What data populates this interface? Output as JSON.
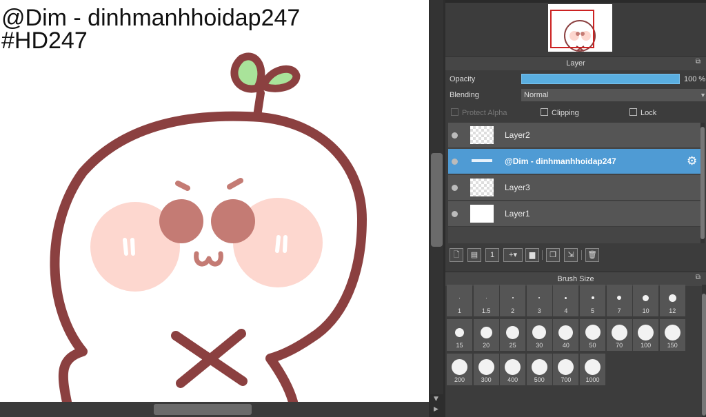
{
  "canvas": {
    "watermark_line1": "@Dim - dinhmanhhoidap247",
    "watermark_line2": "#HD247"
  },
  "navigator": {
    "thumb_caption": "@Dim - dinhmanhhoidap247"
  },
  "layer_panel": {
    "title": "Layer",
    "opacity_label": "Opacity",
    "opacity_value_text": "100 %",
    "opacity_percent": 100,
    "blending_label": "Blending",
    "blending_value": "Normal",
    "protect_alpha_label": "Protect Alpha",
    "clipping_label": "Clipping",
    "lock_label": "Lock",
    "layers": [
      {
        "name": "Layer2",
        "selected": false,
        "thumb": "checker"
      },
      {
        "name": "@Dim - dinhmanhhoidap247",
        "selected": true,
        "thumb": "text"
      },
      {
        "name": "Layer3",
        "selected": false,
        "thumb": "checker"
      },
      {
        "name": "Layer1",
        "selected": false,
        "thumb": "white"
      }
    ],
    "toolbar_icons": [
      "new-layer-icon",
      "new-raster-layer-icon",
      "new-1bit-layer-icon",
      "add-layer-dropdown-icon",
      "new-folder-icon",
      "duplicate-layer-icon",
      "merge-down-icon",
      "delete-layer-icon"
    ]
  },
  "brush_panel": {
    "title": "Brush Size",
    "sizes": [
      [
        {
          "label": "1",
          "d": 1
        },
        {
          "label": "1.5",
          "d": 1
        },
        {
          "label": "2",
          "d": 2
        },
        {
          "label": "3",
          "d": 2
        },
        {
          "label": "4",
          "d": 3
        },
        {
          "label": "5",
          "d": 4
        },
        {
          "label": "7",
          "d": 6
        },
        {
          "label": "10",
          "d": 9
        },
        {
          "label": "12",
          "d": 11
        }
      ],
      [
        {
          "label": "15",
          "d": 13
        },
        {
          "label": "20",
          "d": 17
        },
        {
          "label": "25",
          "d": 19
        },
        {
          "label": "30",
          "d": 20
        },
        {
          "label": "40",
          "d": 21
        },
        {
          "label": "50",
          "d": 22
        },
        {
          "label": "70",
          "d": 23
        },
        {
          "label": "100",
          "d": 23
        },
        {
          "label": "150",
          "d": 23
        }
      ],
      [
        {
          "label": "200",
          "d": 23
        },
        {
          "label": "300",
          "d": 23
        },
        {
          "label": "400",
          "d": 23
        },
        {
          "label": "500",
          "d": 23
        },
        {
          "label": "700",
          "d": 23
        },
        {
          "label": "1000",
          "d": 23
        }
      ]
    ]
  },
  "colors": {
    "accent": "#4f9bd4",
    "outline": "#8b4040",
    "cheek": "#fdd7cf",
    "eye": "#c47b74",
    "sprout": "#a9e39a"
  }
}
